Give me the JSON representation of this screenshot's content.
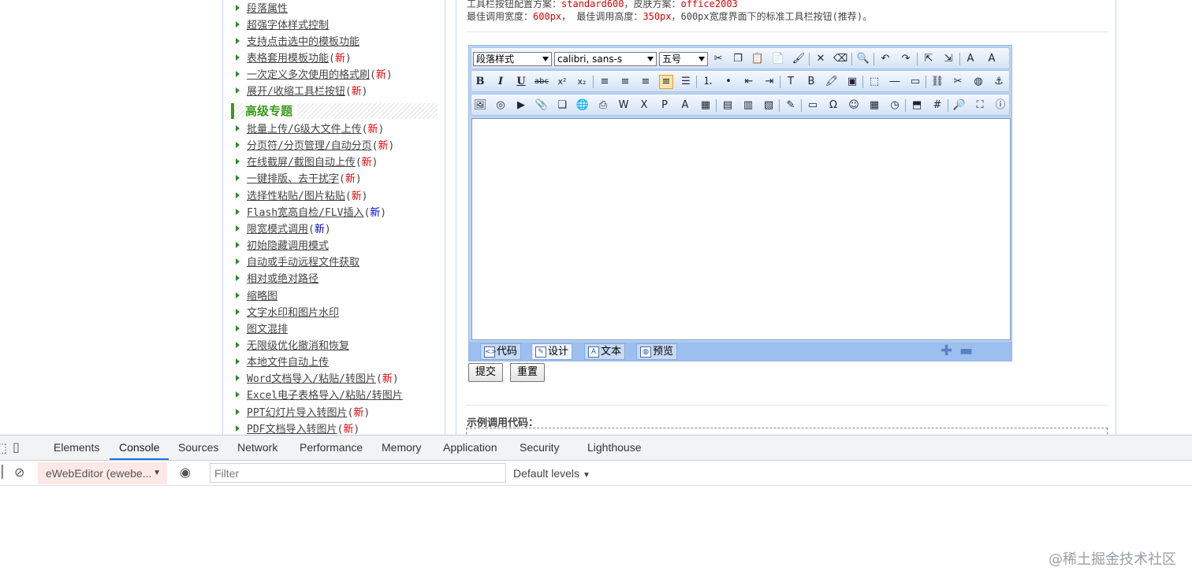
{
  "sidebar": {
    "items_top": [
      {
        "label": "段落属性",
        "badge": ""
      },
      {
        "label": "超强字体样式控制",
        "badge": ""
      },
      {
        "label": "支持点击选中的模板功能",
        "badge": ""
      },
      {
        "label": "表格套用模板功能",
        "badge": "新"
      },
      {
        "label": "一次定义多次使用的格式刷",
        "badge": "新"
      },
      {
        "label": "展开/收缩工具栏按钮",
        "badge": "新"
      }
    ],
    "section_heading": "高级专题",
    "items_advanced": [
      {
        "label": "批量上传/G级大文件上传",
        "badge": "新",
        "badge_color": "red"
      },
      {
        "label": "分页符/分页管理/自动分页",
        "badge": "新",
        "badge_color": "red"
      },
      {
        "label": "在线截屏/截图自动上传",
        "badge": "新",
        "badge_color": "red"
      },
      {
        "label": "一键排版、去干扰字",
        "badge": "新",
        "badge_color": "red"
      },
      {
        "label": "选择性粘贴/图片粘贴",
        "badge": "新",
        "badge_color": "red"
      },
      {
        "label": "Flash宽高自检/FLV插入",
        "badge": "新",
        "badge_color": "blue"
      },
      {
        "label": "限宽模式调用",
        "badge": "新",
        "badge_color": "blue"
      },
      {
        "label": "初始隐藏调用模式",
        "badge": "",
        "badge_color": ""
      },
      {
        "label": "自动或手动远程文件获取",
        "badge": "",
        "badge_color": ""
      },
      {
        "label": "相对或绝对路径",
        "badge": "",
        "badge_color": ""
      },
      {
        "label": "缩略图",
        "badge": "",
        "badge_color": ""
      },
      {
        "label": "文字水印和图片水印",
        "badge": "",
        "badge_color": ""
      },
      {
        "label": "图文混排",
        "badge": "",
        "badge_color": ""
      },
      {
        "label": "无限级优化撤消和恢复",
        "badge": "",
        "badge_color": ""
      },
      {
        "label": "本地文件自动上传",
        "badge": "",
        "badge_color": ""
      },
      {
        "label": "Word文档导入/粘贴/转图片",
        "badge": "新",
        "badge_color": "red"
      },
      {
        "label": "Excel电子表格导入/粘贴/转图片",
        "badge": "",
        "badge_color": ""
      },
      {
        "label": "PPT幻灯片导入转图片",
        "badge": "新",
        "badge_color": "red"
      },
      {
        "label": "PDF文档导入转图片",
        "badge": "新",
        "badge_color": "red"
      }
    ]
  },
  "main": {
    "config_line_prefix": "工具栏按钮配置方案：",
    "config_toolbar_value": "standard600",
    "config_skin_prefix": "，皮肤方案：",
    "config_skin_value": "office2003",
    "size_line_prefix": "最佳调用宽度：",
    "size_width_value": "600px",
    "size_mid": "， 最佳调用高度：",
    "size_height_value": "350px",
    "size_suffix": "，600px宽度界面下的标准工具栏按钮(推荐)。",
    "editor": {
      "paragraph_style": "段落样式",
      "font_family": "calibri, sans-s",
      "font_size": "五号",
      "mode_tabs": [
        "代码",
        "设计",
        "文本",
        "预览"
      ],
      "active_mode": "设计"
    },
    "submit_label": "提交",
    "reset_label": "重置",
    "code_label": "示例调用代码："
  },
  "devtools": {
    "tabs": [
      "Elements",
      "Console",
      "Sources",
      "Network",
      "Performance",
      "Memory",
      "Application",
      "Security",
      "Lighthouse"
    ],
    "active_tab": "Console",
    "context": "eWebEditor (ewebe...",
    "filter_placeholder": "Filter",
    "levels": "Default levels"
  },
  "watermark": "@稀土掘金技术社区"
}
